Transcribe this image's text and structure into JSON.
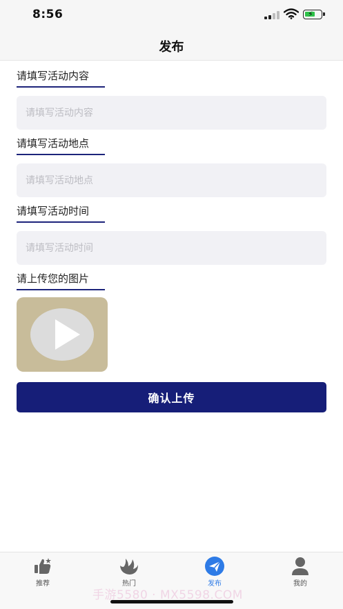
{
  "status_bar": {
    "time": "8:56",
    "battery_color": "#2fc24a"
  },
  "nav": {
    "title": "发布"
  },
  "form": {
    "content": {
      "label": "请填写活动内容",
      "placeholder": "请填写活动内容",
      "value": ""
    },
    "location": {
      "label": "请填写活动地点",
      "placeholder": "请填写活动地点",
      "value": ""
    },
    "time": {
      "label": "请填写活动时间",
      "placeholder": "请填写活动时间",
      "value": ""
    },
    "image": {
      "label": "请上传您的图片",
      "thumbnail_icon": "play-icon"
    },
    "submit_label": "确认上传"
  },
  "tab_bar": {
    "items": [
      {
        "label": "推荐",
        "icon": "thumbs-up-icon",
        "active": false
      },
      {
        "label": "热门",
        "icon": "bird-icon",
        "active": false
      },
      {
        "label": "发布",
        "icon": "send-icon",
        "active": true
      },
      {
        "label": "我的",
        "icon": "user-icon",
        "active": false
      }
    ],
    "active_color": "#2e7be6"
  },
  "watermark": "手游5580 · MX5598.COM",
  "colors": {
    "accent": "#161e78",
    "field_bg": "#f1f1f5"
  }
}
